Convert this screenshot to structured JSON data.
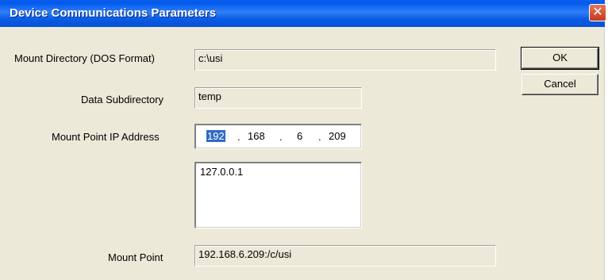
{
  "window": {
    "title": "Device Communications Parameters",
    "close_glyph": "✕"
  },
  "fields": {
    "mount_directory": {
      "label": "Mount Directory (DOS Format)",
      "value": "c:\\usi"
    },
    "data_subdirectory": {
      "label": "Data Subdirectory",
      "value": "temp"
    },
    "mount_point_ip": {
      "label": "Mount Point IP Address",
      "octets": [
        "192",
        "168",
        "6",
        "209"
      ],
      "separator": "."
    },
    "ip_list": {
      "items": [
        "127.0.0.1"
      ]
    },
    "mount_point": {
      "label": "Mount Point",
      "value": "192.168.6.209:/c/usi"
    }
  },
  "buttons": {
    "ok_label": "OK",
    "cancel_label": "Cancel"
  },
  "colors": {
    "title_bar": "#0a5ce6",
    "dialog_bg": "#ece9d8",
    "selection": "#316ac5",
    "close_button": "#c8381b"
  }
}
